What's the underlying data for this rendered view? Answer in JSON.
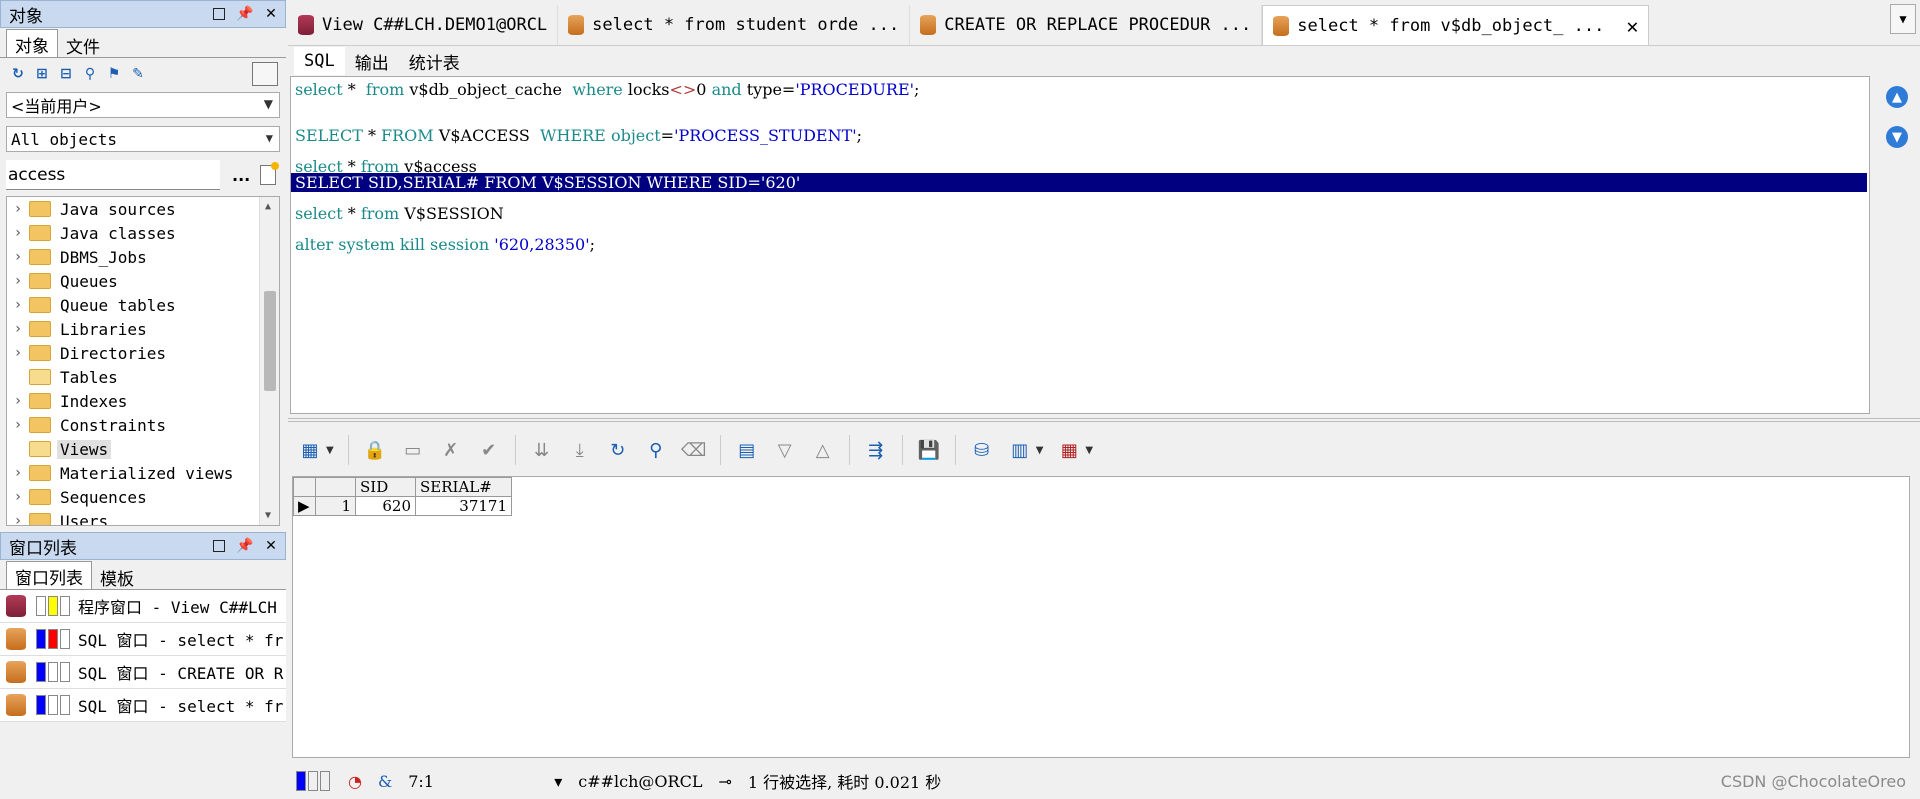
{
  "objects_panel": {
    "title": "对象",
    "tabs": [
      "对象",
      "文件"
    ],
    "owner_combo": "<当前用户>",
    "filter_combo": "All objects",
    "search_value": "access",
    "search_more": "...",
    "tree": [
      {
        "label": "Java sources",
        "expandable": true,
        "open": false
      },
      {
        "label": "Java classes",
        "expandable": true,
        "open": false
      },
      {
        "label": "DBMS_Jobs",
        "expandable": true,
        "open": false
      },
      {
        "label": "Queues",
        "expandable": true,
        "open": false
      },
      {
        "label": "Queue tables",
        "expandable": true,
        "open": false
      },
      {
        "label": "Libraries",
        "expandable": true,
        "open": false
      },
      {
        "label": "Directories",
        "expandable": true,
        "open": false
      },
      {
        "label": "Tables",
        "expandable": false,
        "open": true
      },
      {
        "label": "Indexes",
        "expandable": true,
        "open": false
      },
      {
        "label": "Constraints",
        "expandable": true,
        "open": false
      },
      {
        "label": "Views",
        "expandable": false,
        "open": true,
        "selected": true
      },
      {
        "label": "Materialized views",
        "expandable": true,
        "open": false
      },
      {
        "label": "Sequences",
        "expandable": true,
        "open": false
      },
      {
        "label": "Users",
        "expandable": true,
        "open": false
      }
    ]
  },
  "window_list": {
    "title": "窗口列表",
    "tabs": [
      "窗口列表",
      "模板"
    ],
    "items": [
      {
        "text": "程序窗口 - View C##LCH",
        "icon": "db-red",
        "colors": [
          "#ffffff",
          "#ffff00",
          "#ffffff"
        ]
      },
      {
        "text": "SQL 窗口 - select * fr",
        "icon": "db-orange",
        "colors": [
          "#0000ff",
          "#ff0000",
          "#ffffff"
        ]
      },
      {
        "text": "SQL 窗口 - CREATE OR R",
        "icon": "db-orange",
        "colors": [
          "#0000ff",
          "#ffffff",
          "#ffffff"
        ]
      },
      {
        "text": "SQL 窗口 - select * fr",
        "icon": "db-orange",
        "colors": [
          "#0000ff",
          "#ffffff",
          "#ffffff"
        ]
      }
    ]
  },
  "doc_tabs": [
    {
      "label": "View C##LCH.DEMO1@ORCL",
      "icon": "db-red",
      "active": false
    },
    {
      "label": "select * from student orde ...",
      "icon": "db-orange",
      "active": false
    },
    {
      "label": "CREATE OR REPLACE PROCEDUR ...",
      "icon": "db-orange",
      "active": false
    },
    {
      "label": "select * from v$db_object_ ...",
      "icon": "db-orange",
      "active": true
    }
  ],
  "sub_tabs": [
    "SQL",
    "输出",
    "统计表"
  ],
  "editor": {
    "highlighted": "SELECT SID,SERIAL# FROM V$SESSION WHERE SID='620'"
  },
  "grid": {
    "columns": [
      "SID",
      "SERIAL#"
    ],
    "rows": [
      {
        "num": "1",
        "SID": "620",
        "SERIAL#": "37171"
      }
    ]
  },
  "status": {
    "cursor_pos": "7:1",
    "connection": "c##lch@ORCL",
    "message": "1 行被选择, 耗时 0.021 秒",
    "amp": "&"
  },
  "watermark": "CSDN @ChocolateOreo"
}
